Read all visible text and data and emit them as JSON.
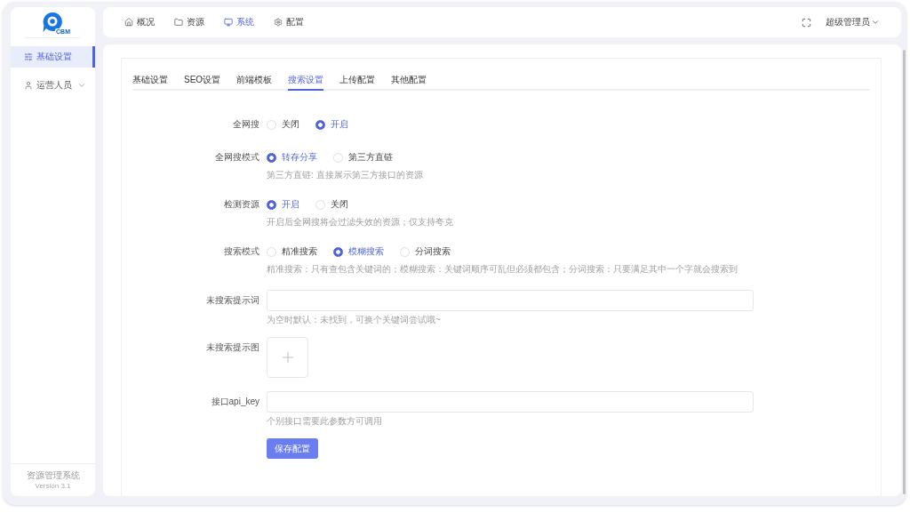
{
  "sidebar": {
    "logo_text": "CBM",
    "items": [
      {
        "kind": "link",
        "label": "基础设置",
        "selected": true
      },
      {
        "kind": "group",
        "label": "运营人员",
        "selected": false,
        "expanded": false
      }
    ],
    "footer_title": "资源管理系统",
    "footer_version": "Version 3.1"
  },
  "topbar": {
    "nav": [
      {
        "label": "概况",
        "selected": false
      },
      {
        "label": "资源",
        "selected": false
      },
      {
        "label": "系统",
        "selected": true
      },
      {
        "label": "配置",
        "selected": false
      }
    ],
    "user": "超级管理员"
  },
  "tabs": [
    {
      "label": "基础设置",
      "selected": false
    },
    {
      "label": "SEO设置",
      "selected": false
    },
    {
      "label": "前端模板",
      "selected": false
    },
    {
      "label": "搜索设置",
      "selected": true
    },
    {
      "label": "上传配置",
      "selected": false
    },
    {
      "label": "其他配置",
      "selected": false
    }
  ],
  "form": {
    "fields": [
      {
        "kind": "radio",
        "label": "全网搜",
        "options": [
          {
            "label": "关闭",
            "selected": false
          },
          {
            "label": "开启",
            "selected": true
          }
        ]
      },
      {
        "kind": "radio",
        "label": "全网搜模式",
        "options": [
          {
            "label": "转存分享",
            "selected": true
          },
          {
            "label": "第三方直链",
            "selected": false
          }
        ],
        "hint": "第三方直链: 直接展示第三方接口的资源"
      },
      {
        "kind": "radio",
        "label": "检测资源",
        "options": [
          {
            "label": "开启",
            "selected": true
          },
          {
            "label": "关闭",
            "selected": false
          }
        ],
        "hint": "开启后全网搜将会过滤失效的资源；仅支持夸克"
      },
      {
        "kind": "radio",
        "label": "搜索模式",
        "options": [
          {
            "label": "精准搜索",
            "selected": false
          },
          {
            "label": "模糊搜索",
            "selected": true
          },
          {
            "label": "分词搜索",
            "selected": false
          }
        ],
        "hint": "精准搜索：只有查包含关键词的；模糊搜索：关键词顺序可乱但必须都包含；分词搜索：只要满足其中一个字就会搜索到"
      },
      {
        "kind": "text",
        "label": "未搜索提示词",
        "hint": "为空时默认：未找到，可换个关键词尝试哦~"
      },
      {
        "kind": "upload",
        "label": "未搜索提示图"
      },
      {
        "kind": "text",
        "label": "接口api_key",
        "hint": "个别接口需要此参数方可调用"
      }
    ],
    "submit": "保存配置"
  }
}
